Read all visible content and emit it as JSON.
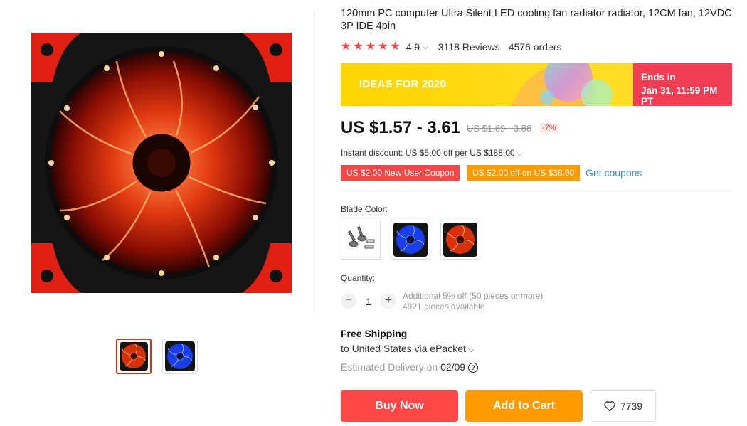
{
  "product": {
    "title": "120mm PC computer Ultra Silent LED cooling fan radiator radiator, 12CM fan, 12VDC 3P IDE 4pin",
    "rating": "4.9",
    "reviews": "3118 Reviews",
    "orders": "4576 orders"
  },
  "banner": {
    "text": "IDEAS FOR 2020",
    "ends_label": "Ends in",
    "ends_date": "Jan 31, 11:59 PM PT"
  },
  "price": {
    "current": "US $1.57 - 3.61",
    "original": "US $1.69 - 3.88",
    "discount": "-7%"
  },
  "instant_discount": "Instant discount: US $5.00 off per US $188.00",
  "coupons": {
    "new_user": "US $2.00 New User Coupon",
    "off": "US $2.00 off on US $38.00",
    "get": "Get coupons"
  },
  "variants": {
    "label": "Blade Color:",
    "options": [
      "screws-icon",
      "blue-fan-icon",
      "red-fan-icon"
    ]
  },
  "quantity": {
    "label": "Quantity:",
    "minus": "−",
    "value": "1",
    "plus": "+",
    "info1": "Additional 5% off (50 pieces or more)",
    "info2": "4921 pieces available"
  },
  "shipping": {
    "title": "Free Shipping",
    "to": "to United States via ePacket",
    "est_label": "Estimated Delivery on ",
    "est_date": "02/09",
    "help": "?"
  },
  "actions": {
    "buy": "Buy Now",
    "cart": "Add to Cart",
    "wishlist_count": "7739"
  },
  "colors": {
    "accent": "#ff4747",
    "orange": "#ff9a00",
    "link": "#3b8bd0",
    "banner_yellow": "#ffd800",
    "ends_red": "#f23d55"
  }
}
